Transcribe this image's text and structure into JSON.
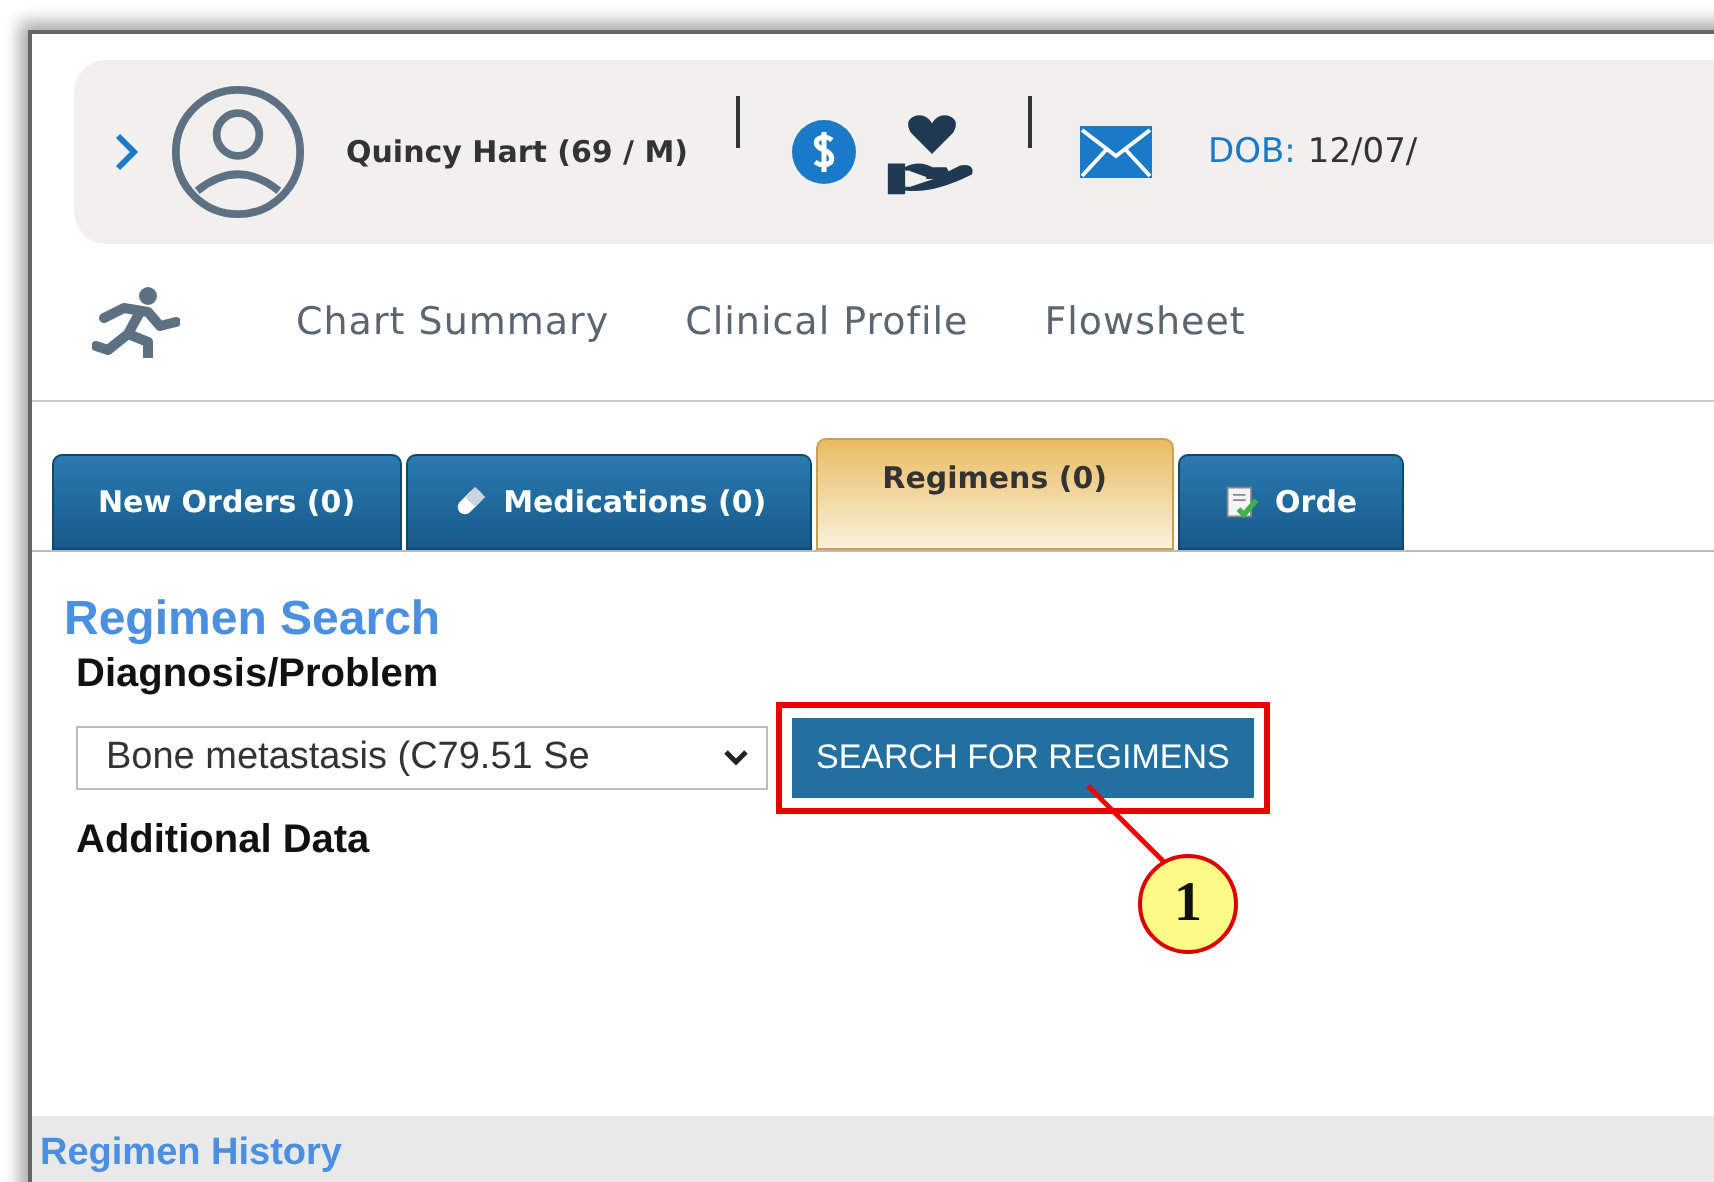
{
  "patient": {
    "name": "Quincy Hart (69 / M)",
    "dob_label": "DOB:",
    "dob_value": "12/07/"
  },
  "nav": [
    "Chart Summary",
    "Clinical Profile",
    "Flowsheet"
  ],
  "tabs": [
    {
      "label": "New Orders (0)",
      "kind": "plain",
      "selected": false
    },
    {
      "label": "Medications (0)",
      "kind": "pill",
      "selected": false
    },
    {
      "label": "Regimens (0)",
      "kind": "plain",
      "selected": true
    },
    {
      "label": "Orde",
      "kind": "document",
      "selected": false
    }
  ],
  "regimen_search": {
    "title": "Regimen Search",
    "diagnosis_label": "Diagnosis/Problem",
    "diagnosis_value": "Bone metastasis (C79.51 Se",
    "button": "SEARCH FOR REGIMENS",
    "additional_label": "Additional Data"
  },
  "callout": {
    "number": "1"
  },
  "history": {
    "title": "Regimen History"
  }
}
